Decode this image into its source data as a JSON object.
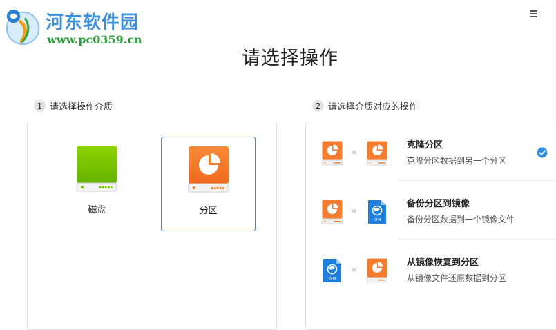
{
  "watermark": {
    "title": "河东软件园",
    "url": "www.pc0359.cn"
  },
  "header": {
    "title": "请选择操作",
    "menu_icon": "hamburger-menu-icon"
  },
  "steps": [
    {
      "number": "1",
      "label": "请选择操作介质"
    },
    {
      "number": "2",
      "label": "请选择介质对应的操作"
    }
  ],
  "media": [
    {
      "label": "磁盘",
      "icon": "disk-icon",
      "selected": false
    },
    {
      "label": "分区",
      "icon": "partition-icon",
      "selected": true
    }
  ],
  "operations": [
    {
      "title": "克隆分区",
      "description": "克隆分区数据到另一个分区",
      "source_icon": "partition-icon",
      "target_icon": "partition-icon",
      "selected": true
    },
    {
      "title": "备份分区到镜像",
      "description": "备份分区数据到一个镜像文件",
      "source_icon": "partition-icon",
      "target_icon": "image-file-icon",
      "target_tag": "DIM",
      "selected": false
    },
    {
      "title": "从镜像恢复到分区",
      "description": "从镜像文件还原数据到分区",
      "source_icon": "image-file-icon",
      "source_tag": "DIM",
      "target_icon": "partition-icon",
      "selected": false
    }
  ],
  "arrow_glyph": "»",
  "colors": {
    "accent": "#2f8fe0",
    "partition_orange": "#f47c2f",
    "disk_green": "#7cc600",
    "image_blue": "#1e7fdc",
    "watermark_blue": "#3d8fd9",
    "watermark_green": "#2aa23a"
  }
}
